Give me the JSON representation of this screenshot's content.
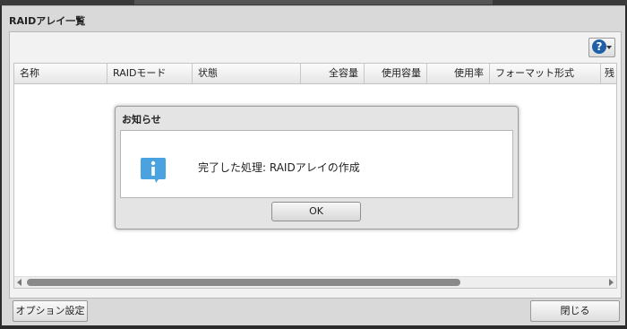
{
  "window": {
    "title": "RAIDアレイ一覧"
  },
  "toolbar": {
    "help_label": "?"
  },
  "table": {
    "columns": [
      "名称",
      "RAIDモード",
      "状態",
      "全容量",
      "使用容量",
      "使用率",
      "フォーマット形式",
      "残り"
    ]
  },
  "footer": {
    "options_label": "オプション設定",
    "close_label": "閉じる"
  },
  "dialog": {
    "title": "お知らせ",
    "message": "完了した処理: RAIDアレイの作成",
    "ok_label": "OK",
    "icon": "info-icon"
  },
  "colors": {
    "info_icon": "#4aa3df",
    "help_icon": "#1e5fa8"
  }
}
